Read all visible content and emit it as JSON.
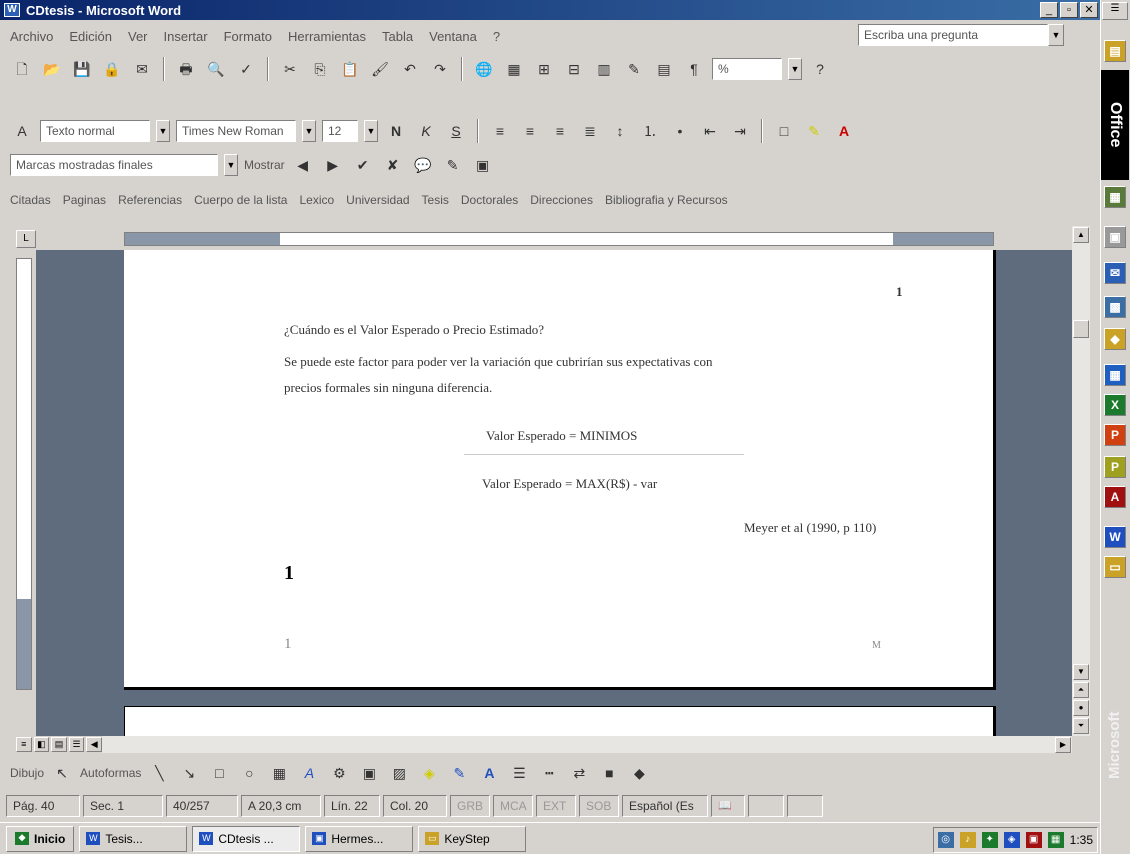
{
  "window": {
    "title": "CDtesis - Microsoft Word"
  },
  "menu": {
    "items": [
      "Archivo",
      "Edición",
      "Ver",
      "Insertar",
      "Formato",
      "Herramientas",
      "Tabla",
      "Ventana",
      "?"
    ],
    "help_placeholder": "Escriba una pregunta"
  },
  "formatting": {
    "style": "Texto normal",
    "font": "Times New Roman",
    "size": "12"
  },
  "reviewing": {
    "view": "Marcas mostradas finales",
    "show_label": "Mostrar"
  },
  "references": {
    "items": [
      "Citadas",
      "Paginas",
      "Referencias",
      "Cuerpo de la lista",
      "Lexico",
      "Universidad",
      "Tesis",
      "Doctorales",
      "Direcciones",
      "Bibliografia y Recursos"
    ]
  },
  "document": {
    "page_number": "1",
    "heading": "¿Cuándo es el Valor Esperado o Precio Estimado?",
    "paragraph_line1": "Se puede este factor para poder ver la variación que cubrirían sus expectativas con",
    "paragraph_line2": "precios formales sin ninguna diferencia.",
    "formula1": "Valor Esperado = MINIMOS",
    "formula2": "Valor Esperado = MAX(R$) - var",
    "citation": "Meyer et al (1990, p 110)",
    "big_number": "1",
    "small_number": "1",
    "small_right": "M"
  },
  "status": {
    "page": "Pág. 40",
    "section": "Sec. 1",
    "pages": "40/257",
    "position": "A 20,3 cm",
    "line": "Lín. 22",
    "col": "Col. 20",
    "grb": "GRB",
    "mca": "MCA",
    "ext": "EXT",
    "sob": "SOB",
    "language": "Español (Es"
  },
  "taskbar": {
    "start": "Inicio",
    "tasks": [
      "Tesis...",
      "CDtesis ...",
      "Hermes...",
      "KeyStep"
    ],
    "clock": "1:35"
  },
  "colors": {
    "titlebar_start": "#0a246a",
    "titlebar_end": "#3a6ea5",
    "document_bg": "#5e6c7e",
    "chrome": "#d6d3ce"
  },
  "office_bar": {
    "logo": "Office",
    "brand": "Microsoft"
  },
  "drawing": {
    "draw_label": "Dibujo",
    "autoshapes_label": "Autoformas"
  }
}
